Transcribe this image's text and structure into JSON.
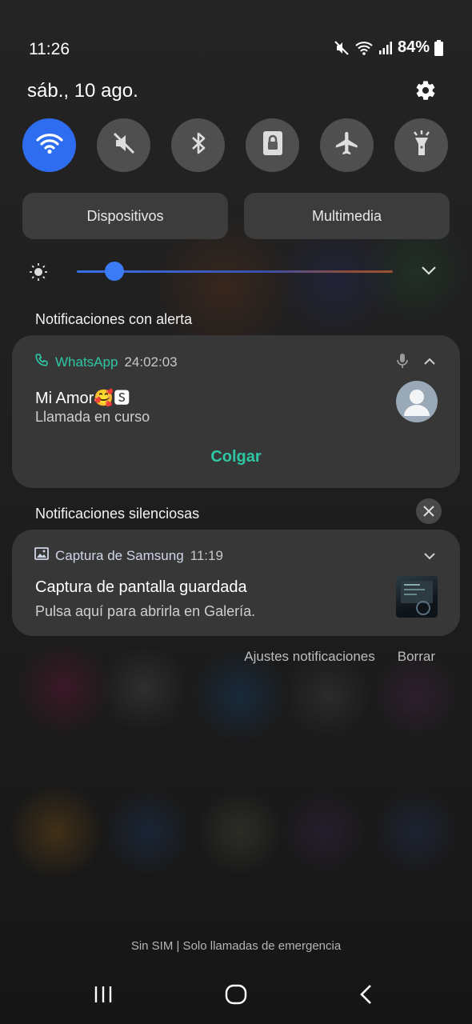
{
  "status_bar": {
    "time": "11:26",
    "battery": "84%",
    "icons": [
      "mute-icon",
      "wifi-icon",
      "signal-icon",
      "battery-icon"
    ]
  },
  "header": {
    "date": "sáb., 10 ago.",
    "settings_icon": "gear-icon"
  },
  "quick_settings": [
    {
      "name": "wifi",
      "icon": "wifi-icon",
      "active": true
    },
    {
      "name": "sound",
      "icon": "mute-icon",
      "active": false
    },
    {
      "name": "bluetooth",
      "icon": "bluetooth-icon",
      "active": false
    },
    {
      "name": "screen-lock",
      "icon": "lock-icon",
      "active": false
    },
    {
      "name": "airplane",
      "icon": "airplane-icon",
      "active": false
    },
    {
      "name": "flashlight",
      "icon": "flashlight-icon",
      "active": false
    }
  ],
  "media_buttons": {
    "devices": "Dispositivos",
    "media": "Multimedia"
  },
  "brightness": {
    "level": 0.12
  },
  "alert_section": {
    "title": "Notificaciones con alerta",
    "notification": {
      "app": "WhatsApp",
      "time": "24:02:03",
      "title": "Mi Amor🥰🆂",
      "text": "Llamada en curso",
      "action": "Colgar"
    }
  },
  "silent_section": {
    "title": "Notificaciones silenciosas",
    "notification": {
      "app": "Captura de Samsung",
      "time": "11:19",
      "title": "Captura de pantalla guardada",
      "text": "Pulsa aquí para abrirla en Galería."
    }
  },
  "footer_links": {
    "settings": "Ajustes notificaciones",
    "clear": "Borrar"
  },
  "carrier": "Sin SIM | Solo llamadas de emergencia",
  "colors": {
    "accent_blue": "#2f6df0",
    "whatsapp_green": "#2ec7a3"
  }
}
